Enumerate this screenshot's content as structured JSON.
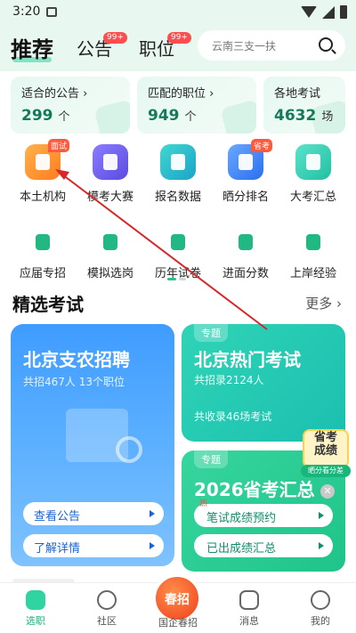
{
  "status": {
    "time": "3:20"
  },
  "header": {
    "tab_main": "推荐",
    "tab2": "公告",
    "tab2_badge": "99+",
    "tab3": "职位",
    "tab3_badge": "99+",
    "search_placeholder": "云南三支一扶"
  },
  "summary_cards": [
    {
      "title": "适合的公告 ›",
      "value": "299",
      "unit": "个"
    },
    {
      "title": "匹配的职位 ›",
      "value": "949",
      "unit": "个"
    },
    {
      "title": "各地考试",
      "value": "4632",
      "unit": "场"
    }
  ],
  "grid": [
    {
      "label": "本土机构",
      "tag": "面试",
      "icon": "building-icon"
    },
    {
      "label": "模考大赛",
      "tag": "",
      "icon": "trophy-icon"
    },
    {
      "label": "报名数据",
      "tag": "",
      "icon": "bar-chart-icon"
    },
    {
      "label": "晒分排名",
      "tag": "省考",
      "icon": "ranking-icon"
    },
    {
      "label": "大考汇总",
      "tag": "",
      "icon": "bell-icon"
    },
    {
      "label": "应届专招",
      "tag": "",
      "icon": "graduate-icon"
    },
    {
      "label": "模拟选岗",
      "tag": "",
      "icon": "cube-icon"
    },
    {
      "label": "历年试卷",
      "tag": "",
      "icon": "document-icon"
    },
    {
      "label": "进面分数",
      "tag": "",
      "icon": "trend-icon"
    },
    {
      "label": "上岸经验",
      "tag": "",
      "icon": "notes-icon"
    }
  ],
  "section": {
    "title": "精选考试",
    "more": "更多 ›"
  },
  "card_left": {
    "title": "北京支农招聘",
    "subtitle": "共招467人 13个职位",
    "btn1": "查看公告",
    "btn2": "了解详情"
  },
  "card_right1": {
    "topic": "专题",
    "title": "北京热门考试",
    "sub1": "共招录2124人",
    "sub2": "共收录46场考试"
  },
  "card_right2": {
    "topic": "专题",
    "title": "2026省考汇总",
    "hot": "热",
    "btn1": "笔试成绩预约",
    "btn2": "已出成绩汇总"
  },
  "float_ad": {
    "line1": "省考",
    "line2": "成绩",
    "strip": "晒分看分差"
  },
  "tabbar": [
    {
      "label": "选职",
      "active": true
    },
    {
      "label": "社区",
      "active": false
    },
    {
      "label": "国企春招",
      "badge": "春招",
      "active": false
    },
    {
      "label": "消息",
      "active": false
    },
    {
      "label": "我的",
      "active": false
    }
  ]
}
